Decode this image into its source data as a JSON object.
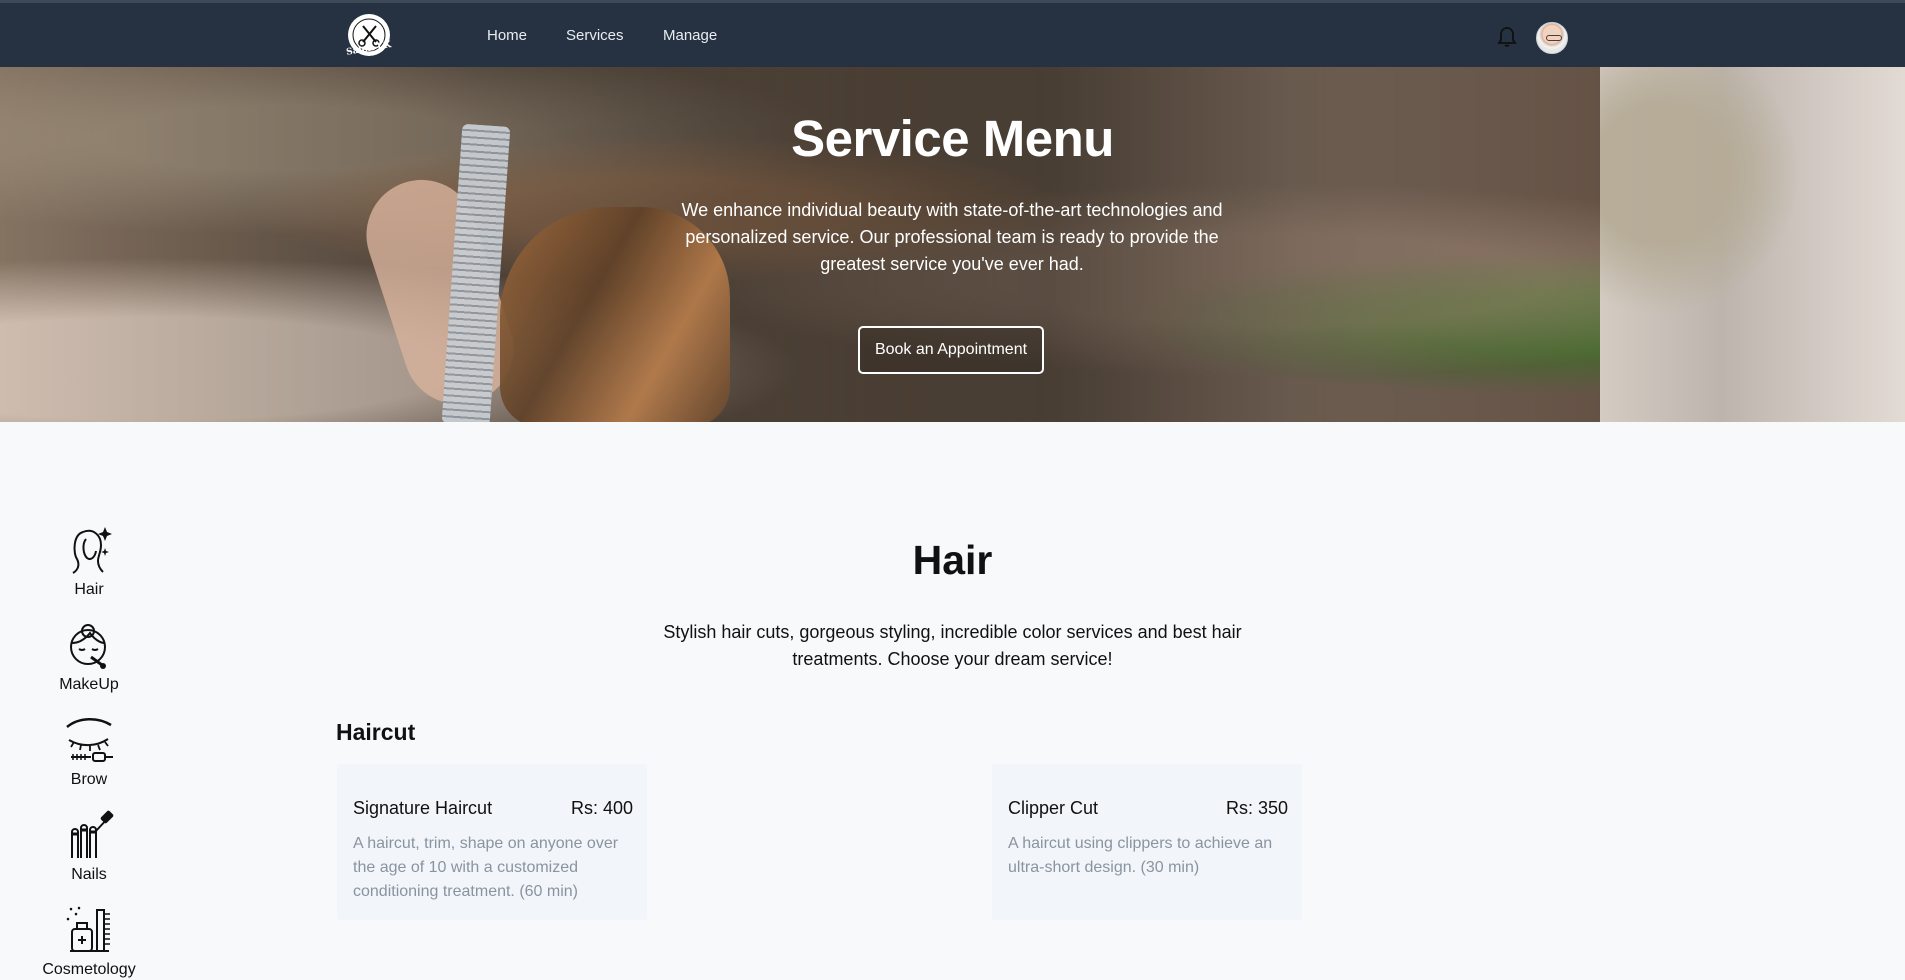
{
  "nav": {
    "logo_text": "Salon LK",
    "links": [
      "Home",
      "Services",
      "Manage"
    ]
  },
  "hero": {
    "title": "Service Menu",
    "description": "We enhance individual beauty with state-of-the-art technologies and personalized service. Our professional team is ready to provide the greatest service you've ever had.",
    "button": "Book an Appointment"
  },
  "sidebar": {
    "items": [
      {
        "label": "Hair",
        "icon": "hair-icon"
      },
      {
        "label": "MakeUp",
        "icon": "makeup-icon"
      },
      {
        "label": "Brow",
        "icon": "brow-icon"
      },
      {
        "label": "Nails",
        "icon": "nails-icon"
      },
      {
        "label": "Cosmetology",
        "icon": "cosmetology-icon"
      }
    ]
  },
  "section": {
    "title": "Hair",
    "description": "Stylish hair cuts, gorgeous styling, incredible color services and best hair treatments. Choose your dream service!",
    "subsection": "Haircut"
  },
  "services": [
    {
      "name": "Signature Haircut",
      "price": "Rs: 400",
      "description": "A haircut, trim, shape on anyone over the age of 10 with a customized conditioning treatment. (60 min)"
    },
    {
      "name": "Clipper Cut",
      "price": "Rs: 350",
      "description": "A haircut using clippers to achieve an ultra-short design. (30 min)"
    }
  ]
}
